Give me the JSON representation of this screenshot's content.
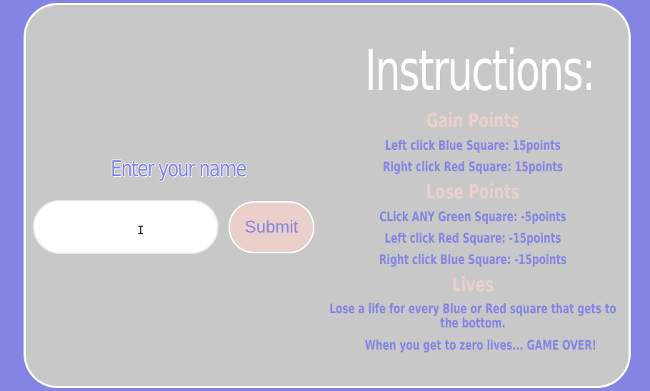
{
  "form": {
    "label": "Enter your name",
    "input_value": "",
    "input_placeholder": "",
    "submit_label": "Submit"
  },
  "instructions": {
    "title": "Instructions:",
    "gain": {
      "heading": "Gain Points",
      "rules": [
        "Left click Blue Square: 15points",
        "Right click Red Square: 15points"
      ]
    },
    "lose": {
      "heading": "Lose Points",
      "rules": [
        "CLick ANY Green Square: -5points",
        "Left click Red Square: -15points",
        "Right click Blue Square: -15points"
      ]
    },
    "lives": {
      "heading": "Lives",
      "rules": [
        "Lose a life for every Blue or Red square that gets to the bottom.",
        "When you get to zero lives... GAME OVER!"
      ]
    }
  },
  "colors": {
    "background": "#8484e4",
    "card": "#c8c8c8",
    "accent_pink": "#ebcfcb",
    "text_purple": "#8484e4"
  }
}
